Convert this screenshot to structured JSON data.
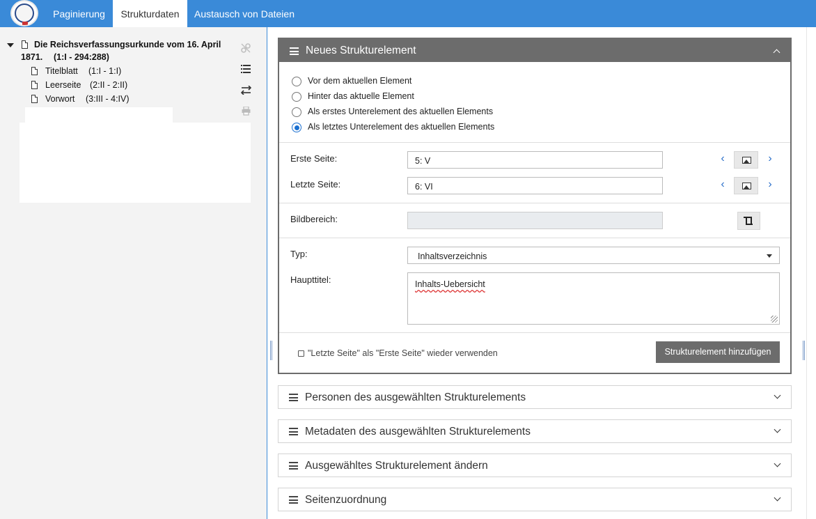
{
  "nav": {
    "tabs": [
      {
        "label": "Paginierung"
      },
      {
        "label": "Strukturdaten"
      },
      {
        "label": "Austausch von Dateien"
      }
    ]
  },
  "tree": {
    "root_title": "Die Reichsverfassungsurkunde vom 16. April",
    "root_title2": "1871.",
    "root_pages": "(1:I - 294:288)",
    "children": [
      {
        "label": "Titelblatt",
        "pages": "(1:I - 1:I)"
      },
      {
        "label": "Leerseite",
        "pages": "(2:II - 2:II)"
      },
      {
        "label": "Vorwort",
        "pages": "(3:III - 4:IV)"
      }
    ]
  },
  "panel_new": {
    "title": "Neues Strukturelement",
    "radios": [
      {
        "label": "Vor dem aktuellen Element",
        "checked": false
      },
      {
        "label": "Hinter das aktuelle Element",
        "checked": false
      },
      {
        "label": "Als erstes Unterelement des aktuellen Elements",
        "checked": false
      },
      {
        "label": "Als letztes Unterelement des aktuellen Elements",
        "checked": true
      }
    ],
    "first_page_label": "Erste Seite:",
    "first_page_value": "5: V",
    "last_page_label": "Letzte Seite:",
    "last_page_value": "6: VI",
    "image_area_label": "Bildbereich:",
    "type_label": "Typ:",
    "type_value": "Inhaltsverzeichnis",
    "main_title_label": "Haupttitel:",
    "main_title_value": "Inhalts-Uebersicht",
    "reuse_label": "\"Letzte Seite\" als \"Erste Seite\" wieder verwenden",
    "add_button": "Strukturelement hinzufügen"
  },
  "collapsed_panels": [
    {
      "title": "Personen des ausgewählten Strukturelements"
    },
    {
      "title": "Metadaten des ausgewählten Strukturelements"
    },
    {
      "title": "Ausgewähltes Strukturelement ändern"
    },
    {
      "title": "Seitenzuordnung"
    }
  ],
  "colors": {
    "topbar": "#3a8ad8",
    "panel_header": "#6c6c6c",
    "accent": "#1a6fd0"
  }
}
